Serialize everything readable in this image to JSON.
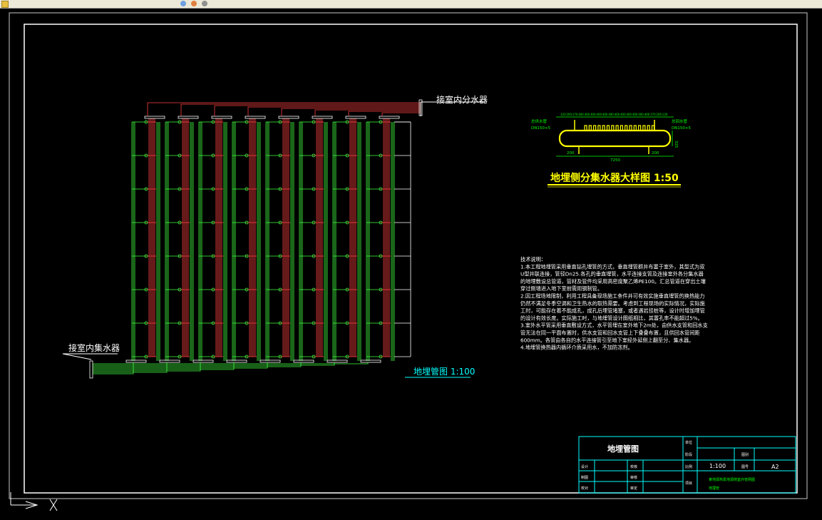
{
  "drawing": {
    "label_supply": "接室内分水器",
    "label_return": "接室内集水器",
    "plan_title": "地埋管图 1:100",
    "detail_title": "地埋侧分集水器大样图 1:50",
    "detail_dims": {
      "top": [
        "120",
        "200",
        "170",
        "400",
        "400",
        "400",
        "400",
        "400",
        "400",
        "400",
        "400",
        "400",
        "400",
        "400",
        "400",
        "170",
        "200",
        "120"
      ],
      "left_pipe": "总供水管",
      "left_size": "DN150×5",
      "right_pipe": "总回水管",
      "right_size": "DN150×5",
      "bottom_left": "200",
      "bottom_mid": "7250",
      "bottom_right": "200",
      "height": "325"
    },
    "notes": [
      "技术说明：",
      "1.本工程地埋管采用垂直钻孔埋管的方式，垂直埋管群井布置于室外，其型式为双",
      "U型并联连接，管径Dn25.各孔的垂直埋管，水平连接支管及连接室外各分集水器",
      "的地埋敷设总管道，管材及管件均采用高密度聚乙烯PE100。汇总管道在穿出土壤",
      "穿过侧墙进入地下室前需用钢制管。",
      "2.因工程场地限制，利用工程具备现场施工条件并可有效实施垂直埋管的换热能力",
      "仍然不满足冬季空调和卫生热水的取热需要。考虑到工程现场的实际情况，实际施",
      "工时，可能存在着不能成孔，成孔后埋管堵塞，或者遇岩挂桩等，设计时增加埋管",
      "的设计有效长度。实际施工时，与地埋管设计图纸相比，其置孔率不能超过5%。",
      "3.室外水平管采用垂直敷设方式，水平管埋在室外地下2m处，由供水支管和回水支",
      "管无法在同一平面布置时，供水支管和回水支管上下叠叠布置，且供回水管间距",
      "600mm。各管由各自的水平连接管引至地下室经外延侧上翻至分、集水器。",
      "4.地埋管换热器内循环介质采用水，不加防冻剂。"
    ]
  },
  "title_block": {
    "name": "地埋管图",
    "design_label": "设计",
    "design_value": "",
    "draw_label": "制图",
    "proof_label": "校对",
    "check_label": "校核",
    "review_label": "审核",
    "approve_label": "审定",
    "scale_label": "比例",
    "scale_value": "1:100",
    "sheet_label": "图号",
    "sheet_value": "A2",
    "date_label": "日期",
    "project_label": "项目",
    "project_value": "某地源热泵地源侧室外管网图",
    "project_sub": "地埋管",
    "unit_label": "单位",
    "stage_label": "阶段",
    "series_label": "图别"
  },
  "colors": {
    "background": "#000000",
    "supply": "#ff4040",
    "return": "#40ff40",
    "frame": "#ffffff",
    "title_block": "#00ffff",
    "detail": "#ffff00",
    "text": "#ffffff"
  }
}
